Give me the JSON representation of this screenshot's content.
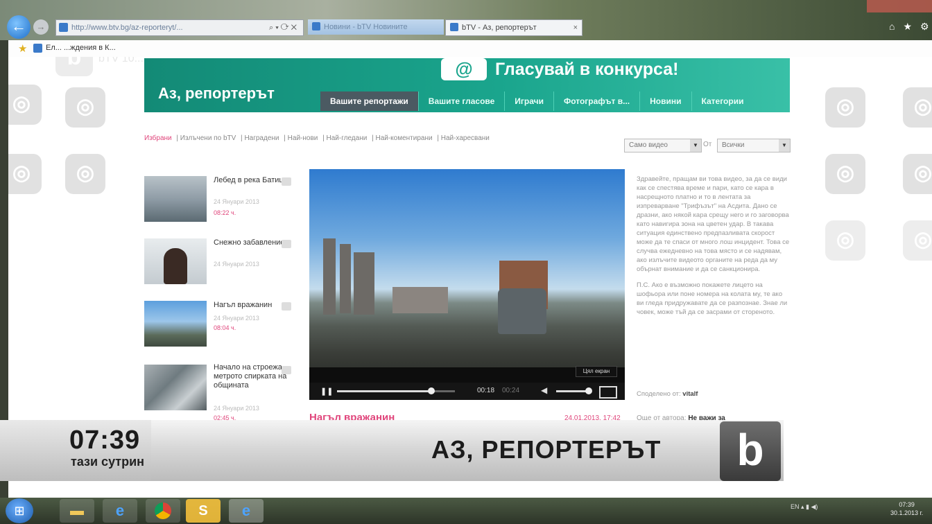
{
  "browser": {
    "address_url": "http://www.btv.bg/az-reporteryt/...",
    "tabs": [
      {
        "title": "Новини - bTV Новините"
      },
      {
        "title": "bTV - Аз, репортерът"
      }
    ],
    "favorites": [
      {
        "label": "Ел... ...ждения в К..."
      }
    ]
  },
  "site": {
    "title": "Аз, репортерът",
    "contest_label": "Гласувай в конкурса!",
    "contest_icon": "at-icon",
    "accent_color": "#1aa58d",
    "pink_color": "#e0457b",
    "nav": [
      {
        "label": "Вашите репортажи",
        "active": true
      },
      {
        "label": "Вашите гласове",
        "active": false
      },
      {
        "label": "Играчи",
        "active": false
      },
      {
        "label": "Фотографът в...",
        "active": false
      },
      {
        "label": "Новини",
        "active": false
      },
      {
        "label": "Категории",
        "active": false
      }
    ],
    "crumbs": [
      "Избрани",
      "Излъчени по bTV",
      "Наградени",
      "Най-нови",
      "Най-гледани",
      "Най-коментирани",
      "Най-харесвани"
    ],
    "filter_1": "Само видео",
    "filter_2": "Всички",
    "filter_label": "От"
  },
  "items": [
    {
      "title": "Лебед в река Батица",
      "date": "24 Януари 2013",
      "time": "08:22 ч."
    },
    {
      "title": "Снежно забавление",
      "date": "24 Януари 2013",
      "time": ""
    },
    {
      "title": "Нагъл вражанин",
      "date": "24 Януари 2013",
      "time": "08:04 ч."
    },
    {
      "title": "Начало на строежа - метрото спирката на общината",
      "date": "24 Януари 2013",
      "time": "02:45 ч."
    }
  ],
  "player": {
    "current_time": "00:18",
    "duration": "00:24",
    "progress": 0.8,
    "tooltip": "Цял екран"
  },
  "video": {
    "title": "Нагъл вражанин",
    "date": "24.01.2013, 17:42",
    "description_1": "Здравейте, пращам ви това видео, за да се види как се спестява време и пари, като се кара в насрещното платно и то в лентата за изпреварване \"Трифъзът\" на Асдита. Дано се дразни, ако някой кара срещу него и го заговорва като навигира зона на цветен удар. В такава ситуация единствено предпазливата скорост може да те спаси от много лош инцидент. Това се случва ежедневно на това място и се надявам, ако излъчите видеото органите на реда да му обърнат внимание и да се санкционира.",
    "description_2": "П.С. Ако е възможно покажете лицето на шофьора или поне номера на колата му, те ако ви гледа придружавате да се разпознае. Знае ли човек, може тъй да се засрами от стореното.",
    "author_label": "Споделено от:",
    "author": "vitalf",
    "more_label": "Още от автора:",
    "more_value": "Не важи за"
  },
  "tv": {
    "clock": "07:39",
    "clock_sub": "тази сутрин",
    "show_title": "АЗ, РЕПОРТЕРЪТ",
    "channel_logo": "b"
  },
  "watermark": {
    "logo": "b",
    "text": "bTV  10:..."
  },
  "taskbar": {
    "lang": "EN",
    "time": "07:39",
    "date": "30.1.2013 г."
  }
}
